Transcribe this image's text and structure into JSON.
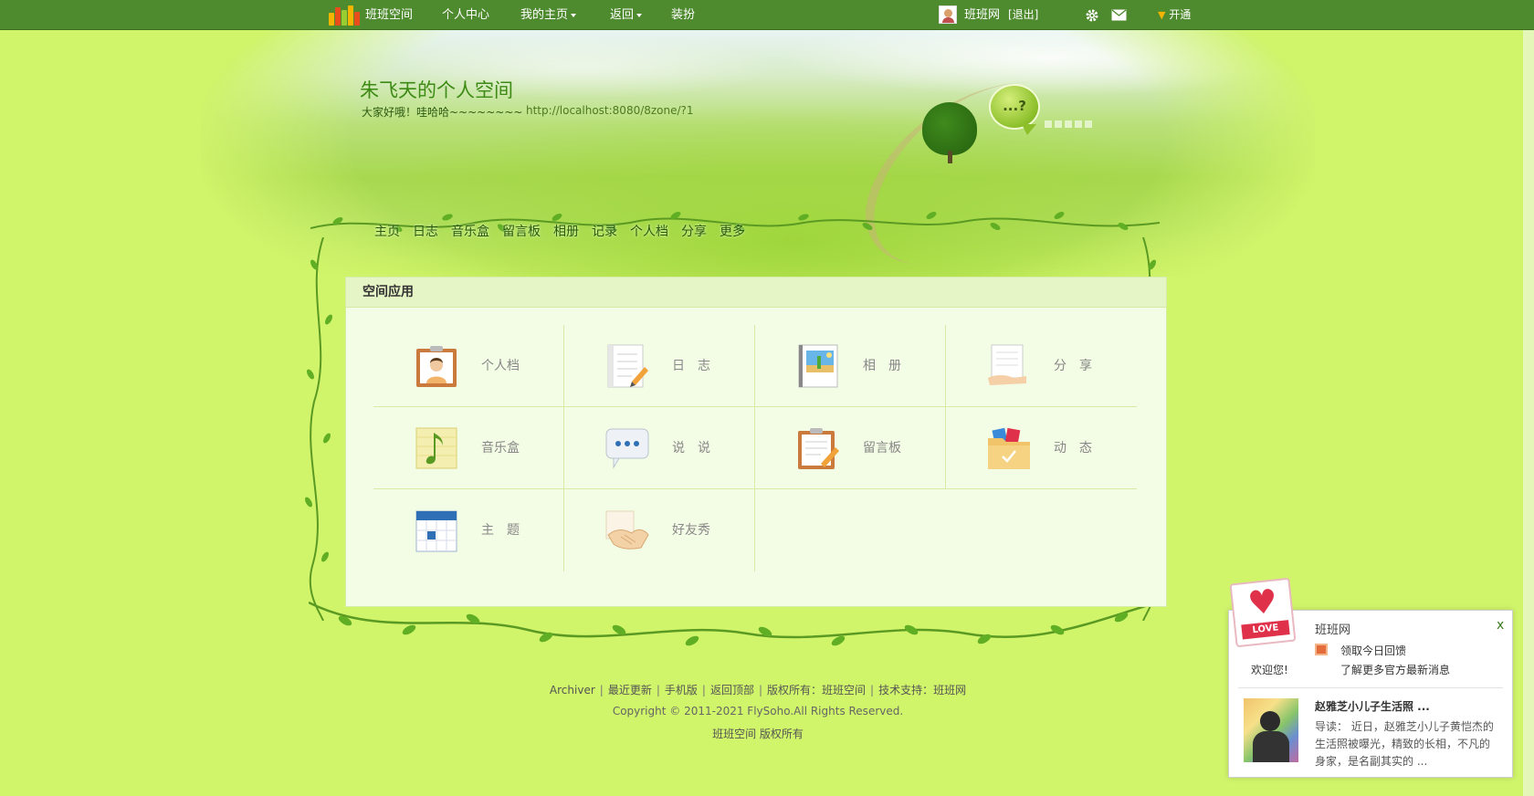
{
  "topbar": {
    "brand": "班班空间",
    "menu": [
      {
        "label": "个人中心",
        "dropdown": false
      },
      {
        "label": "我的主页",
        "dropdown": true
      },
      {
        "label": "返回",
        "dropdown": true
      },
      {
        "label": "装扮",
        "dropdown": false
      }
    ],
    "user_name": "班班网",
    "logout": "[退出]",
    "settings_icon": "gear-icon",
    "mail_icon": "mail-icon",
    "vip_label": "开通",
    "colors": {
      "bar": "#4e8a2e",
      "vip": "#f4b400"
    }
  },
  "banner": {
    "title": "朱飞天的个人空间",
    "motto": "大家好哦！哇哈哈~~~~~~~~",
    "url": "http://localhost:8080/8zone/?1",
    "bubble_text": "...?"
  },
  "nav": [
    "主页",
    "日志",
    "音乐盒",
    "留言板",
    "相册",
    "记录",
    "个人档",
    "分享",
    "更多"
  ],
  "panel": {
    "title": "空间应用",
    "apps": [
      {
        "label": "个人档",
        "icon": "profile-card-icon"
      },
      {
        "label": "日　志",
        "icon": "notebook-pencil-icon"
      },
      {
        "label": "相　册",
        "icon": "photo-album-icon"
      },
      {
        "label": "分　享",
        "icon": "share-hand-icon"
      },
      {
        "label": "音乐盒",
        "icon": "music-note-icon"
      },
      {
        "label": "说　说",
        "icon": "speech-bubble-icon"
      },
      {
        "label": "留言板",
        "icon": "clipboard-pencil-icon"
      },
      {
        "label": "动　态",
        "icon": "folder-check-icon"
      },
      {
        "label": "主　题",
        "icon": "calendar-icon"
      },
      {
        "label": "好友秀",
        "icon": "handshake-icon"
      }
    ]
  },
  "footer": {
    "links": [
      "Archiver",
      "最近更新",
      "手机版",
      "返回顶部",
      "版权所有：班班空间",
      "技术支持：班班网"
    ],
    "copyright": "Copyright © 2011-2021 FlySoho.All Rights Reserved.",
    "owner": "班班空间 版权所有"
  },
  "popup": {
    "brand": "班班网",
    "close": "x",
    "love_tag": "LOVE",
    "line1": "领取今日回馈",
    "welcome": "欢迎您!",
    "line2": "了解更多官方最新消息",
    "news_title": "赵雅芝小儿子生活照 ...",
    "news_body": "导读： 近日，赵雅芝小儿子黄恺杰的生活照被曝光，精致的长相，不凡的身家，是名副其实的 ..."
  }
}
